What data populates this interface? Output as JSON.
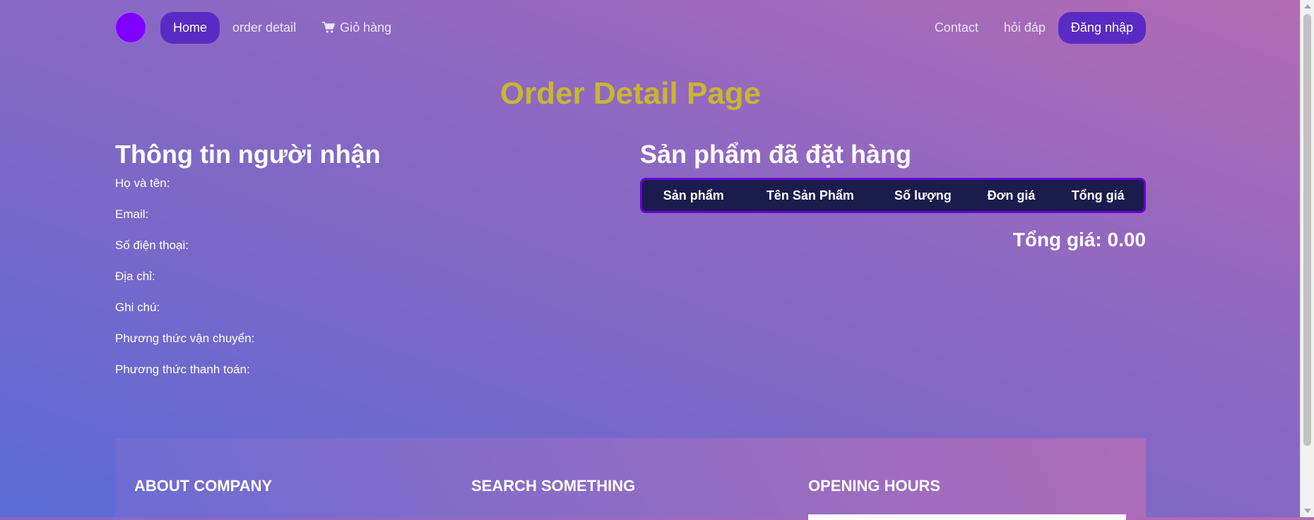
{
  "nav": {
    "home": "Home",
    "order_detail": "order detail",
    "cart": "Giỏ hàng",
    "contact": "Contact",
    "faq": "hỏi đáp",
    "login": "Đăng nhập"
  },
  "page": {
    "title": "Order Detail Page"
  },
  "recipient": {
    "title": "Thông tin người nhận",
    "fields": [
      "Họ và tên:",
      "Email:",
      "Số điện thoại:",
      "Địa chỉ:",
      "Ghi chú:",
      "Phương thức vận chuyển:",
      "Phương thức thanh toán:"
    ]
  },
  "order": {
    "title": "Sản phẩm đã đặt hàng",
    "columns": [
      "Sản phẩm",
      "Tên Sản Phẩm",
      "Số lượng",
      "Đơn giá",
      "Tổng giá"
    ],
    "total": "Tổng giá: 0.00"
  },
  "footer": {
    "about": "ABOUT COMPANY",
    "search": "SEARCH SOMETHING",
    "hours": "OPENING HOURS"
  },
  "colors": {
    "accent": "#5a2bc4",
    "title": "#c9b630",
    "logo": "#7f00ff",
    "table_header": "#1b1c4e"
  }
}
